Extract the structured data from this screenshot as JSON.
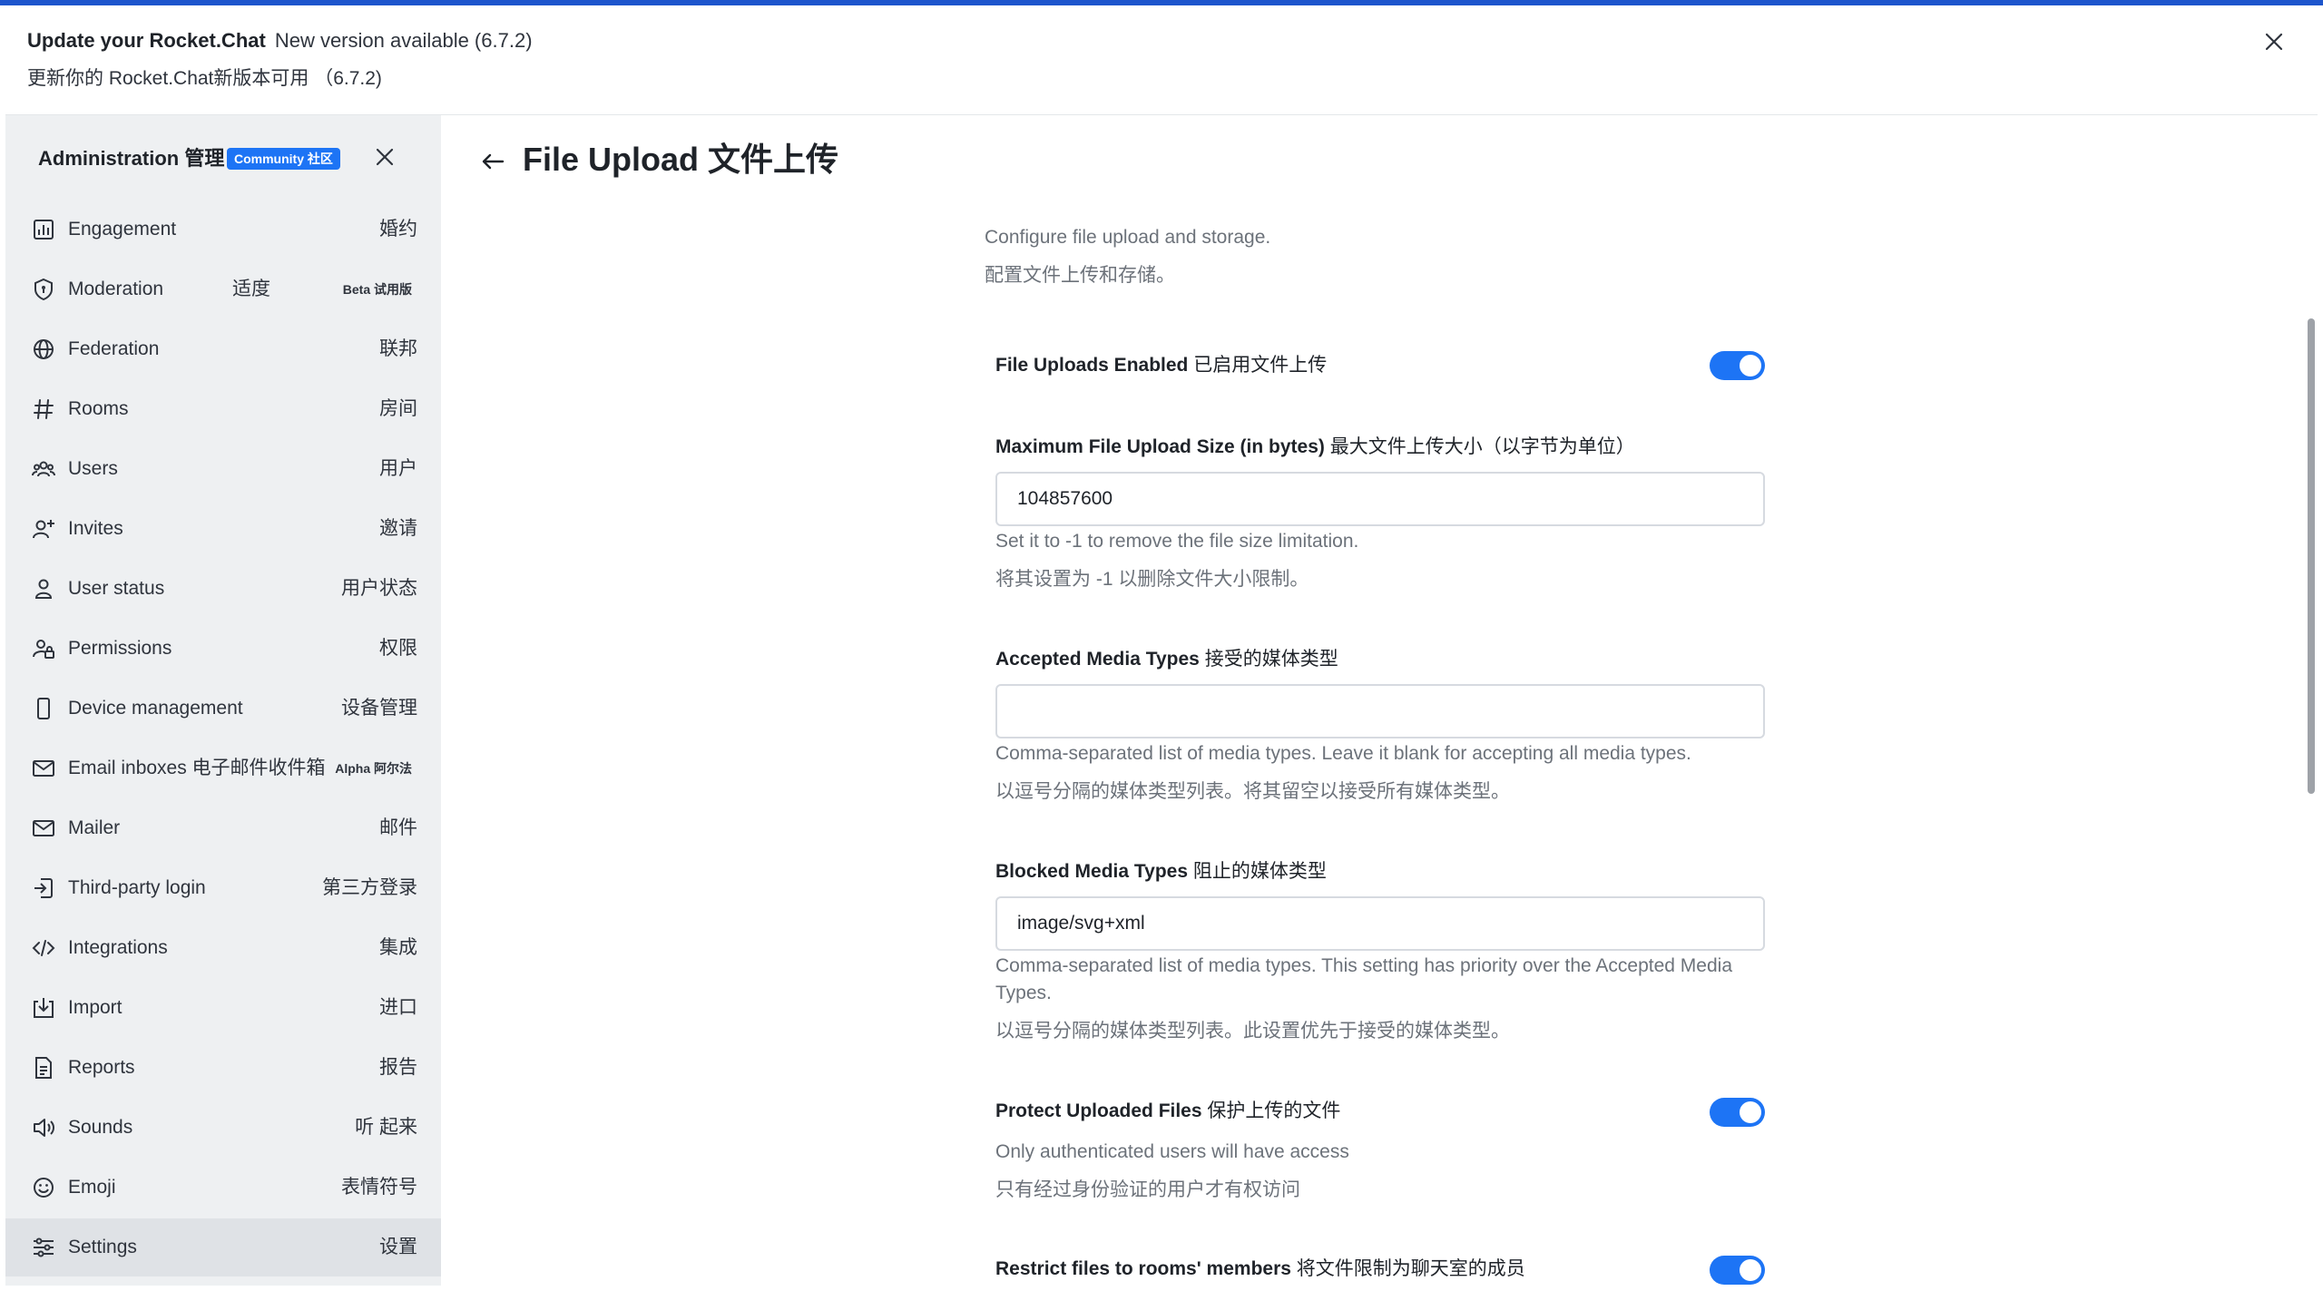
{
  "banner": {
    "title": "Update your Rocket.Chat",
    "subtitle": "New version available (6.7.2)",
    "translation": "更新你的 Rocket.Chat新版本可用 （6.7.2)"
  },
  "sidebar": {
    "title": "Administration 管理",
    "badge": "Community 社区",
    "items": [
      {
        "label": "Engagement",
        "right": "婚约",
        "icon": "bar-chart-icon"
      },
      {
        "label": "Moderation",
        "mid": "适度",
        "tag": "Beta 试用版",
        "icon": "shield-icon"
      },
      {
        "label": "Federation",
        "right": "联邦",
        "icon": "globe-icon"
      },
      {
        "label": "Rooms",
        "right": "房间",
        "icon": "hash-icon"
      },
      {
        "label": "Users",
        "right": "用户",
        "icon": "team-icon"
      },
      {
        "label": "Invites",
        "right": "邀请",
        "icon": "user-plus-icon"
      },
      {
        "label": "User status",
        "right": "用户状态",
        "icon": "user-icon"
      },
      {
        "label": "Permissions",
        "right": "权限",
        "icon": "user-lock-icon"
      },
      {
        "label": "Device management",
        "right": "设备管理",
        "icon": "mobile-icon"
      },
      {
        "label": "Email inboxes 电子邮件收件箱",
        "tag": "Alpha 阿尔法",
        "icon": "mail-icon"
      },
      {
        "label": "Mailer",
        "right": "邮件",
        "icon": "mail-icon"
      },
      {
        "label": "Third-party login",
        "right": "第三方登录",
        "icon": "login-icon"
      },
      {
        "label": "Integrations",
        "right": "集成",
        "icon": "code-icon"
      },
      {
        "label": "Import",
        "right": "进口",
        "icon": "import-icon"
      },
      {
        "label": "Reports",
        "right": "报告",
        "icon": "document-icon"
      },
      {
        "label": "Sounds",
        "right": "听 起来",
        "icon": "volume-icon"
      },
      {
        "label": "Emoji",
        "right": "表情符号",
        "icon": "emoji-icon"
      },
      {
        "label": "Settings",
        "right": "设置",
        "icon": "settings-sliders-icon",
        "active": true
      }
    ]
  },
  "page": {
    "title": "File Upload 文件上传",
    "description": "Configure file upload and storage.",
    "description_cn": "配置文件上传和存储。"
  },
  "settings": {
    "uploads_enabled": {
      "label": "File Uploads Enabled",
      "label_cn": "已启用文件上传",
      "value": true
    },
    "max_size": {
      "label": "Maximum File Upload Size (in bytes)",
      "label_cn": "最大文件上传大小（以字节为单位）",
      "value": "104857600",
      "hint": "Set it to -1 to remove the file size limitation.",
      "hint_cn": "将其设置为 -1 以删除文件大小限制。"
    },
    "accepted_types": {
      "label": "Accepted Media Types",
      "label_cn": "接受的媒体类型",
      "value": "",
      "hint": "Comma-separated list of media types. Leave it blank for accepting all media types.",
      "hint_cn": "以逗号分隔的媒体类型列表。将其留空以接受所有媒体类型。"
    },
    "blocked_types": {
      "label": "Blocked Media Types",
      "label_cn": "阻止的媒体类型",
      "value": "image/svg+xml",
      "hint": "Comma-separated list of media types. This setting has priority over the Accepted Media Types.",
      "hint_cn": "以逗号分隔的媒体类型列表。此设置优先于接受的媒体类型。"
    },
    "protect_files": {
      "label": "Protect Uploaded Files",
      "label_cn": "保护上传的文件",
      "value": true,
      "hint": "Only authenticated users will have access",
      "hint_cn": "只有经过身份验证的用户才有权访问"
    },
    "restrict_rooms": {
      "label": "Restrict files to rooms' members",
      "label_cn": "将文件限制为聊天室的成员",
      "value": true
    }
  },
  "colors": {
    "accent": "#1d74f5",
    "top_bar": "#1d55cc",
    "sidebar_bg": "#eef0f2",
    "sidebar_active": "#dfe2e6",
    "text_primary": "#1f2329",
    "text_secondary": "#6c727a"
  }
}
